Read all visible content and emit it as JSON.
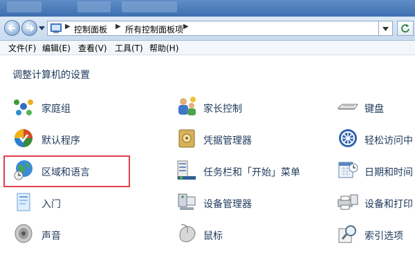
{
  "colors": {
    "highlight": "#e0404a",
    "link_text": "#1e395b"
  },
  "breadcrumb": {
    "root_icon": "control-panel-icon",
    "items": [
      "控制面板",
      "所有控制面板项"
    ]
  },
  "menu": [
    "文件(F)",
    "编辑(E)",
    "查看(V)",
    "工具(T)",
    "帮助(H)"
  ],
  "main": {
    "title": "调整计算机的设置",
    "items": [
      {
        "label": "家庭组",
        "icon": "homegroup-icon"
      },
      {
        "label": "家长控制",
        "icon": "parental-controls-icon"
      },
      {
        "label": "键盘",
        "icon": "keyboard-icon"
      },
      {
        "label": "默认程序",
        "icon": "default-programs-icon"
      },
      {
        "label": "凭据管理器",
        "icon": "credential-manager-icon"
      },
      {
        "label": "轻松访问中",
        "icon": "ease-of-access-icon"
      },
      {
        "label": "区域和语言",
        "icon": "region-language-icon"
      },
      {
        "label": "任务栏和「开始」菜单",
        "icon": "taskbar-start-menu-icon"
      },
      {
        "label": "日期和时间",
        "icon": "date-time-icon"
      },
      {
        "label": "入门",
        "icon": "getting-started-icon"
      },
      {
        "label": "设备管理器",
        "icon": "device-manager-icon"
      },
      {
        "label": "设备和打印",
        "icon": "devices-printers-icon"
      },
      {
        "label": "声音",
        "icon": "sound-icon"
      },
      {
        "label": "鼠标",
        "icon": "mouse-icon"
      },
      {
        "label": "索引选项",
        "icon": "indexing-options-icon"
      }
    ]
  }
}
